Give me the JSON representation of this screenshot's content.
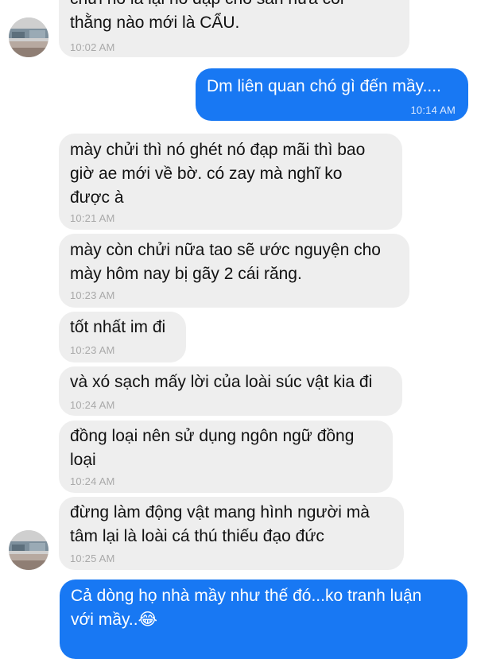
{
  "colors": {
    "incoming_bubble": "#eeeeee",
    "outgoing_bubble": "#1878f3",
    "timestamp_incoming": "#a9a9a9",
    "timestamp_outgoing": "#dbe9ff"
  },
  "avatar": {
    "icon": "contact-avatar-icon"
  },
  "messages": [
    {
      "dir": "in",
      "text": "chửi nó là lại nó đạp cho sân nữa coi\nthằng nào mới là CẨU.",
      "time": "10:02 AM"
    },
    {
      "dir": "out",
      "text": "Dm liên quan chó gì đến mầy....",
      "time": "10:14 AM"
    },
    {
      "dir": "in",
      "text": "mày chửi thì nó ghét nó đạp mãi thì bao\ngiờ ae mới về bờ. có zay mà nghĩ ko\nđược à",
      "time": "10:21 AM"
    },
    {
      "dir": "in",
      "text": "mày còn chửi nữa tao sẽ ước nguyện cho\nmày hôm nay bị gãy 2 cái răng.",
      "time": "10:23 AM"
    },
    {
      "dir": "in",
      "text": "tốt nhất im đi",
      "time": "10:23 AM"
    },
    {
      "dir": "in",
      "text": "và xó sạch mấy lời của loài súc vật kia đi",
      "time": "10:24 AM"
    },
    {
      "dir": "in",
      "text": "đồng loại nên sử dụng ngôn ngữ đồng\nloại",
      "time": "10:24 AM"
    },
    {
      "dir": "in",
      "text": "đừng làm động vật mang hình người mà\ntâm lại là loài cá thú thiếu đạo đức",
      "time": "10:25 AM"
    },
    {
      "dir": "out",
      "text": "Cả dòng họ nhà mầy như thế đó...ko tranh luận\nvới mầy..😂",
      "time": ""
    }
  ]
}
